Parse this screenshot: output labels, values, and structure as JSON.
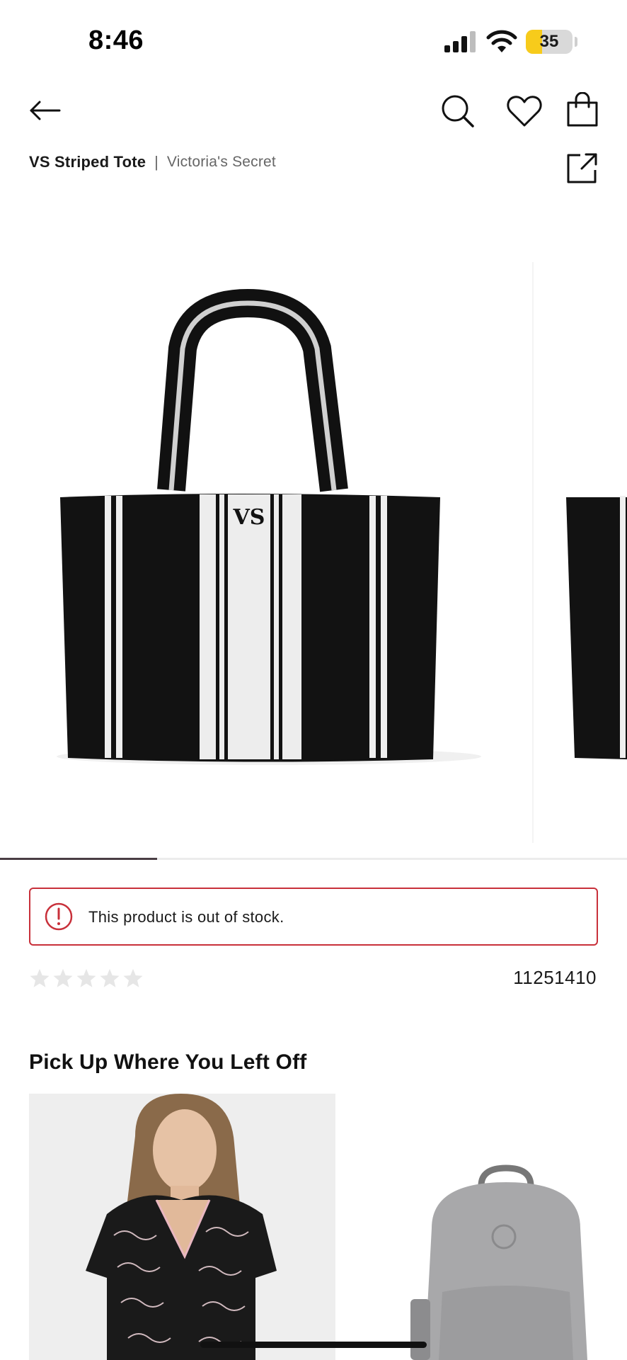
{
  "status_bar": {
    "time": "8:46",
    "battery_level": "35",
    "battery_fraction": 0.35
  },
  "header": {
    "back_icon": "arrow-left-icon",
    "search_icon": "search-icon",
    "wishlist_icon": "heart-icon",
    "bag_icon": "shopping-bag-icon",
    "share_icon": "share-icon"
  },
  "product": {
    "name": "VS Striped Tote",
    "separator": "|",
    "brand": "Victoria's Secret",
    "gallery_progress": 0.25,
    "stock_message": "This product is out of stock.",
    "rating_stars": 5,
    "rating_value": 0,
    "sku": "11251410"
  },
  "recommendations": {
    "title": "Pick Up Where You Left Off",
    "items": [
      {
        "image": "printed-pajama-set"
      },
      {
        "image": "gray-backpack"
      }
    ]
  },
  "colors": {
    "alert_border": "#c8303a",
    "progress": "#4a3d44",
    "star_empty": "#e6e6e6",
    "battery": "#f7cb1b"
  }
}
